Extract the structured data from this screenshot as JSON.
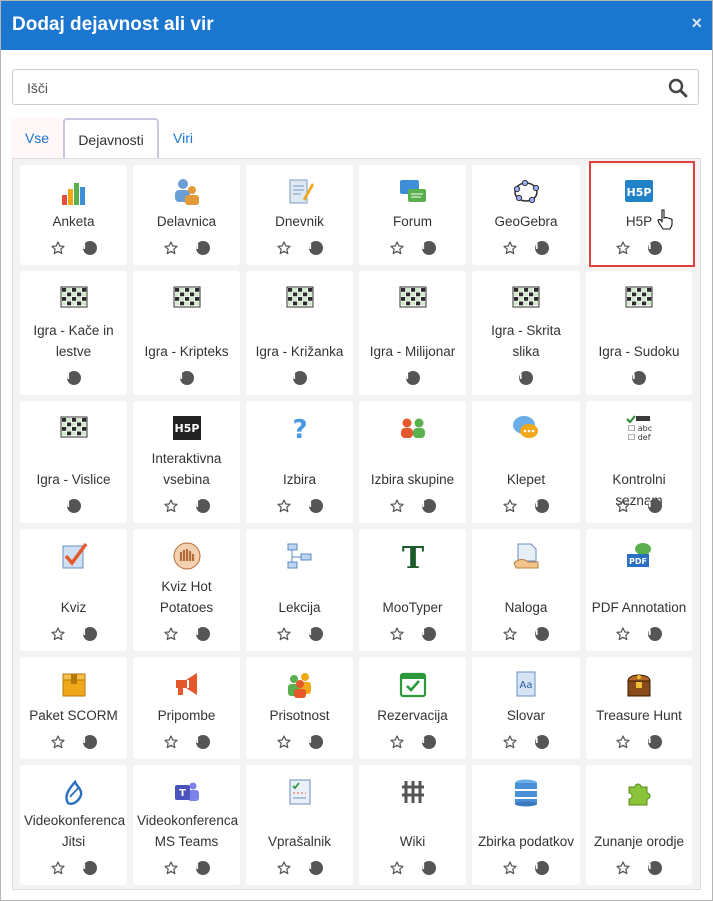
{
  "dialog": {
    "title": "Dodaj dejavnost ali vir",
    "close_glyph": "×"
  },
  "search": {
    "placeholder": "Išči"
  },
  "tabs": [
    {
      "label": "Vse"
    },
    {
      "label": "Dejavnosti"
    },
    {
      "label": "Viri"
    }
  ],
  "colors": {
    "header_bg": "#1b76d0",
    "highlight": "#e0413f",
    "link": "#1b76d0"
  },
  "items": [
    {
      "label": "Anketa",
      "icon": "bar-chart-icon",
      "star": true
    },
    {
      "label": "Delavnica",
      "icon": "workshop-icon",
      "star": true
    },
    {
      "label": "Dnevnik",
      "icon": "journal-icon",
      "star": true
    },
    {
      "label": "Forum",
      "icon": "forum-icon",
      "star": true
    },
    {
      "label": "GeoGebra",
      "icon": "geogebra-icon",
      "star": true
    },
    {
      "label": "H5P",
      "icon": "h5p-icon",
      "star": true
    },
    {
      "label": "Igra - Kače in lestve",
      "icon": "game-grid-icon",
      "star": false
    },
    {
      "label": "Igra - Kripteks",
      "icon": "game-grid-icon",
      "star": false
    },
    {
      "label": "Igra - Križanka",
      "icon": "game-grid-icon",
      "star": false
    },
    {
      "label": "Igra - Milijonar",
      "icon": "game-grid-icon",
      "star": false
    },
    {
      "label": "Igra - Skrita slika",
      "icon": "game-grid-icon",
      "star": false
    },
    {
      "label": "Igra - Sudoku",
      "icon": "game-grid-icon",
      "star": false
    },
    {
      "label": "Igra - Vislice",
      "icon": "game-grid-icon",
      "star": false
    },
    {
      "label": "Interaktivna vsebina",
      "icon": "h5p-dark-icon",
      "star": true
    },
    {
      "label": "Izbira",
      "icon": "question-icon",
      "star": true
    },
    {
      "label": "Izbira skupine",
      "icon": "group-choice-icon",
      "star": true
    },
    {
      "label": "Klepet",
      "icon": "chat-icon",
      "star": true
    },
    {
      "label": "Kontrolni seznam",
      "icon": "checklist-icon",
      "star": true
    },
    {
      "label": "Kviz",
      "icon": "quiz-icon",
      "star": true
    },
    {
      "label": "Kviz Hot Potatoes",
      "icon": "hotpot-icon",
      "star": true
    },
    {
      "label": "Lekcija",
      "icon": "lesson-icon",
      "star": true
    },
    {
      "label": "MooTyper",
      "icon": "mootyper-icon",
      "star": true
    },
    {
      "label": "Naloga",
      "icon": "assignment-icon",
      "star": true
    },
    {
      "label": "PDF Annotation",
      "icon": "pdf-icon",
      "star": true
    },
    {
      "label": "Paket SCORM",
      "icon": "scorm-icon",
      "star": true
    },
    {
      "label": "Pripombe",
      "icon": "feedback-icon",
      "star": true
    },
    {
      "label": "Prisotnost",
      "icon": "attendance-icon",
      "star": true
    },
    {
      "label": "Rezervacija",
      "icon": "calendar-check-icon",
      "star": true
    },
    {
      "label": "Slovar",
      "icon": "glossary-icon",
      "star": true
    },
    {
      "label": "Treasure Hunt",
      "icon": "treasure-icon",
      "star": true
    },
    {
      "label": "Videokonferenca Jitsi",
      "icon": "jitsi-icon",
      "star": true
    },
    {
      "label": "Videokonferenca MS Teams",
      "icon": "teams-icon",
      "star": true
    },
    {
      "label": "Vprašalnik",
      "icon": "questionnaire-icon",
      "star": true
    },
    {
      "label": "Wiki",
      "icon": "wiki-icon",
      "star": true
    },
    {
      "label": "Zbirka podatkov",
      "icon": "database-icon",
      "star": true
    },
    {
      "label": "Zunanje orodje",
      "icon": "puzzle-icon",
      "star": true
    }
  ]
}
